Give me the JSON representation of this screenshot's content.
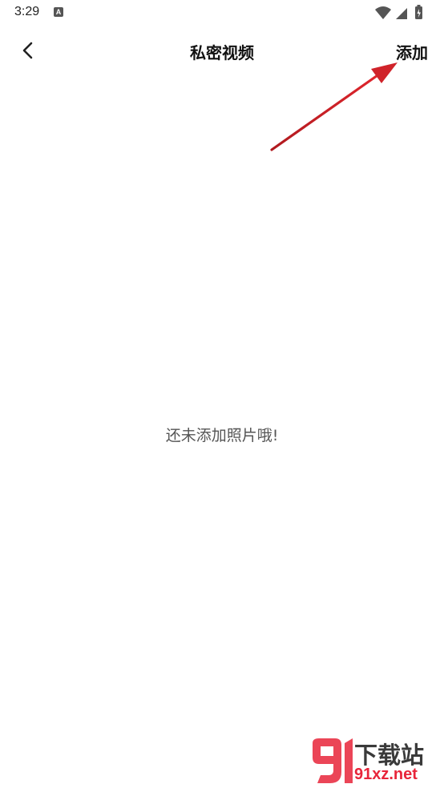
{
  "status_bar": {
    "time": "3:29",
    "notification_icon_letter": "A",
    "icons": [
      "wifi-icon",
      "signal-icon",
      "battery-icon"
    ]
  },
  "nav": {
    "title": "私密视频",
    "add_label": "添加",
    "back_icon": "chevron-left-icon"
  },
  "content": {
    "empty_message": "还未添加照片哦!"
  },
  "annotation": {
    "arrow_color": "#d0232a"
  },
  "watermark": {
    "top_text": "下载站",
    "bottom_text": "91xz.net",
    "accent_color": "#e8253a"
  }
}
